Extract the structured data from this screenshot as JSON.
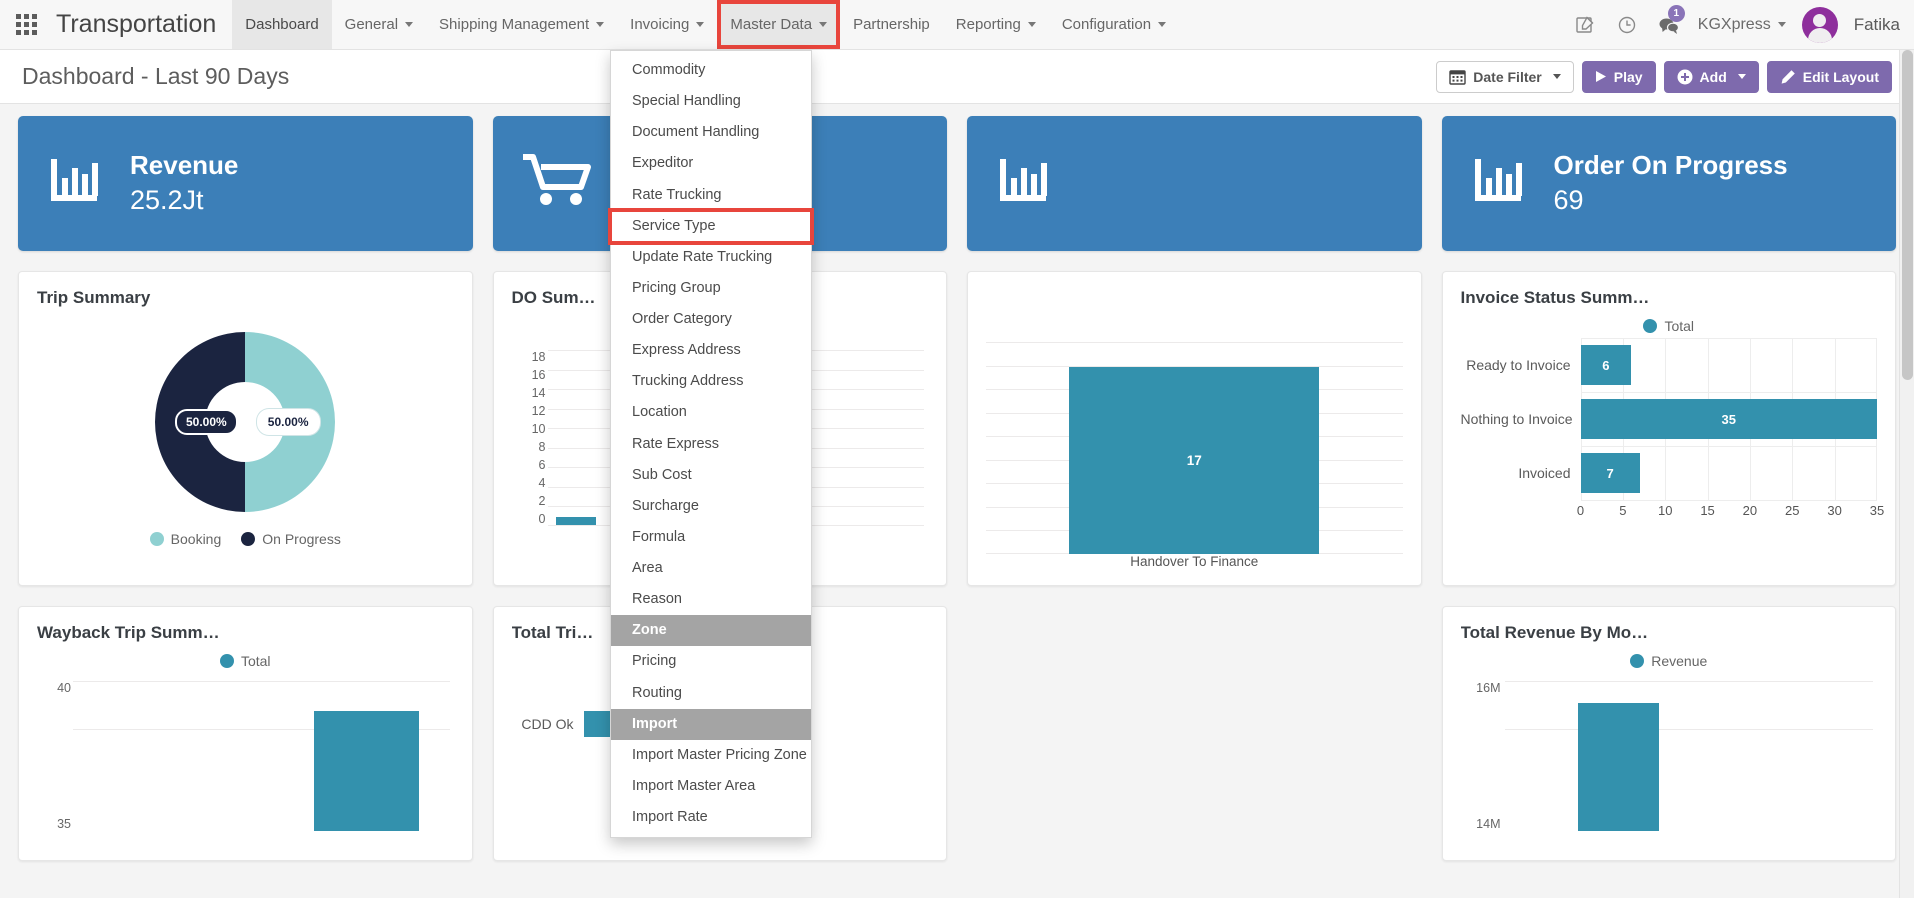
{
  "topnav": {
    "apps_icon": "grid-apps-icon",
    "brand": "Transportation",
    "items": [
      {
        "label": "Dashboard",
        "has_caret": false,
        "active": true
      },
      {
        "label": "General",
        "has_caret": true,
        "active": false
      },
      {
        "label": "Shipping Management",
        "has_caret": true,
        "active": false
      },
      {
        "label": "Invoicing",
        "has_caret": true,
        "active": false
      },
      {
        "label": "Master Data",
        "has_caret": true,
        "active": true,
        "highlighted": true
      },
      {
        "label": "Partnership",
        "has_caret": false,
        "active": false
      },
      {
        "label": "Reporting",
        "has_caret": true,
        "active": false
      },
      {
        "label": "Configuration",
        "has_caret": true,
        "active": false
      }
    ],
    "right": {
      "compose_icon": "compose-note-icon",
      "clock_icon": "clock-icon",
      "chat_icon": "chat-bubble-icon",
      "chat_badge": "1",
      "org_label": "KGXpress",
      "avatar_icon": "user-avatar",
      "username": "Fatika"
    }
  },
  "dropdown": {
    "title": "Master Data",
    "items": [
      {
        "label": "Commodity",
        "type": "item"
      },
      {
        "label": "Special Handling",
        "type": "item"
      },
      {
        "label": "Document Handling",
        "type": "item"
      },
      {
        "label": "Expeditor",
        "type": "item"
      },
      {
        "label": "Rate Trucking",
        "type": "item"
      },
      {
        "label": "Service Type",
        "type": "item",
        "highlighted": true
      },
      {
        "label": "Update Rate Trucking",
        "type": "item"
      },
      {
        "label": "Pricing Group",
        "type": "item"
      },
      {
        "label": "Order Category",
        "type": "item"
      },
      {
        "label": "Express Address",
        "type": "item"
      },
      {
        "label": "Trucking Address",
        "type": "item"
      },
      {
        "label": "Location",
        "type": "item"
      },
      {
        "label": "Rate Express",
        "type": "item"
      },
      {
        "label": "Sub Cost",
        "type": "item"
      },
      {
        "label": "Surcharge",
        "type": "item"
      },
      {
        "label": "Formula",
        "type": "item"
      },
      {
        "label": "Area",
        "type": "item"
      },
      {
        "label": "Reason",
        "type": "item"
      },
      {
        "label": "Zone",
        "type": "header"
      },
      {
        "label": "Pricing",
        "type": "item"
      },
      {
        "label": "Routing",
        "type": "item"
      },
      {
        "label": "Import",
        "type": "header"
      },
      {
        "label": "Import Master Pricing Zone",
        "type": "item"
      },
      {
        "label": "Import Master Area",
        "type": "item"
      },
      {
        "label": "Import Rate",
        "type": "item"
      }
    ]
  },
  "pagehead": {
    "title": "Dashboard - Last 90 Days",
    "date_filter": {
      "icon": "calendar-icon",
      "label": "Date Filter"
    },
    "play": {
      "icon": "play-icon",
      "label": "Play"
    },
    "add": {
      "icon": "plus-circle-icon",
      "label": "Add"
    },
    "edit_layout": {
      "icon": "pencil-icon",
      "label": "Edit Layout"
    }
  },
  "kpis": [
    {
      "title": "Revenue",
      "value": "25.2Jt",
      "icon": "bar-chart-icon"
    },
    {
      "title": "",
      "value": "",
      "icon": "shopping-cart-icon"
    },
    {
      "title": "",
      "value": "",
      "icon": "bar-chart-icon"
    },
    {
      "title": "Order On Progress",
      "value": "69",
      "icon": "bar-chart-icon"
    }
  ],
  "panels": {
    "trip_summary": {
      "title": "Trip Summary"
    },
    "do_summary": {
      "title": "DO Sum…"
    },
    "middle_chart": {
      "title": ""
    },
    "invoice_status": {
      "title": "Invoice Status Summ…"
    },
    "wayback_trip": {
      "title": "Wayback Trip Summ…"
    },
    "total_trip": {
      "title": "Total Tri…"
    },
    "total_revenue": {
      "title": "Total Revenue By Mo…"
    }
  },
  "colors": {
    "kpi_blue": "#3c7fb8",
    "bar_teal": "#3391ad",
    "donut_light": "#8fd0d1",
    "donut_dark": "#1b2440",
    "purple": "#7e6aad",
    "highlight_red": "#e8453c",
    "menu_header_gray": "#a4a4a4"
  },
  "chart_data": [
    {
      "id": "trip_summary",
      "type": "pie",
      "title": "Trip Summary",
      "labels": [
        "Booking",
        "On Progress"
      ],
      "values": [
        50.0,
        50.0
      ],
      "value_labels": [
        "50.00%",
        "50.00%"
      ],
      "colors": [
        "#8fd0d1",
        "#1b2440"
      ],
      "legend": "bottom",
      "donut": true
    },
    {
      "id": "do_summary",
      "type": "bar",
      "title": "DO Sum…",
      "categories": [
        ""
      ],
      "values": [
        0.4
      ],
      "ylabel": "",
      "xlabel": "",
      "ylim": [
        0,
        18
      ],
      "yticks": [
        18,
        16,
        14,
        12,
        10,
        8,
        6,
        4,
        2,
        0
      ],
      "grid": true,
      "color": "#3391ad"
    },
    {
      "id": "middle_chart",
      "type": "bar",
      "title": "",
      "categories": [
        "Handover To Finance"
      ],
      "values": [
        17
      ],
      "value_labels": [
        "17"
      ],
      "ylim": [
        0,
        18
      ],
      "grid": true,
      "color": "#3391ad"
    },
    {
      "id": "invoice_status",
      "type": "bar",
      "orientation": "horizontal",
      "title": "Invoice Status Summ…",
      "legend": [
        "Total"
      ],
      "legend_position": "top",
      "categories": [
        "Ready to Invoice",
        "Nothing to Invoice",
        "Invoiced"
      ],
      "values": [
        6,
        35,
        7
      ],
      "value_labels": [
        "6",
        "35",
        "7"
      ],
      "xticks": [
        0,
        5,
        10,
        15,
        20,
        25,
        30,
        35
      ],
      "xlim": [
        0,
        35
      ],
      "grid": true,
      "color": "#3391ad"
    },
    {
      "id": "wayback_trip",
      "type": "bar",
      "title": "Wayback Trip Summ…",
      "legend": [
        "Total"
      ],
      "legend_position": "top",
      "categories": [
        ""
      ],
      "values": [
        38
      ],
      "yticks": [
        40,
        35
      ],
      "ylim": [
        0,
        40
      ],
      "grid": true,
      "color": "#3391ad"
    },
    {
      "id": "total_trip",
      "type": "bar",
      "title": "Total Tri…",
      "categories": [
        "CDD Ok"
      ],
      "values": [
        0
      ],
      "grid": true,
      "color": "#3391ad"
    },
    {
      "id": "total_revenue",
      "type": "bar",
      "title": "Total Revenue By Mo…",
      "legend": [
        "Revenue"
      ],
      "legend_position": "top",
      "categories": [
        ""
      ],
      "values": [
        14
      ],
      "yticks": [
        "16M",
        "14M"
      ],
      "ylim": [
        0,
        16
      ],
      "grid": true,
      "color": "#3391ad"
    }
  ]
}
